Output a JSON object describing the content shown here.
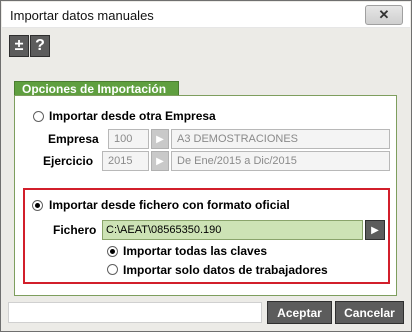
{
  "window": {
    "title": "Importar datos manuales",
    "close_icon": "close-icon"
  },
  "toolbar": {
    "plus_minus_label": "±",
    "help_label": "?"
  },
  "section": {
    "tab_label": "Opciones de Importación"
  },
  "option_empresa": {
    "label": "Importar desde otra Empresa",
    "selected": false,
    "empresa_label": "Empresa",
    "empresa_code": "100",
    "empresa_name": "A3 DEMOSTRACIONES",
    "ejercicio_label": "Ejercicio",
    "ejercicio_year": "2015",
    "ejercicio_range": "De Ene/2015 a Dic/2015"
  },
  "option_fichero": {
    "label": "Importar desde fichero con formato oficial",
    "selected": true,
    "fichero_label": "Fichero",
    "fichero_path": "C:\\AEAT\\08565350.190",
    "sub_options": [
      {
        "label": "Importar todas las claves",
        "selected": true
      },
      {
        "label": "Importar solo datos de trabajadores",
        "selected": false
      }
    ]
  },
  "actions": {
    "accept_label": "Aceptar",
    "cancel_label": "Cancelar"
  },
  "colors": {
    "accent_green": "#5f9f3f",
    "highlight_red": "#d21f2b",
    "file_field_green": "#cde3b5",
    "button_dark": "#5c5c5c"
  }
}
